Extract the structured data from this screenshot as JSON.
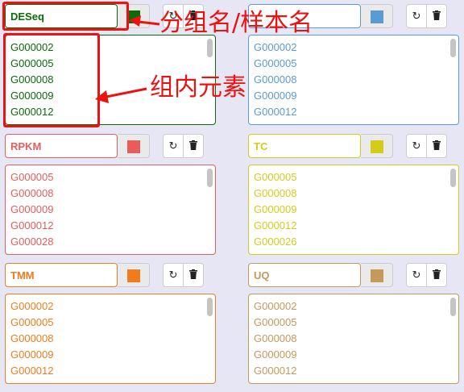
{
  "groups": [
    {
      "name": "DESeq",
      "color": "#0a6b0a",
      "items": [
        "G000002",
        "G000005",
        "G000008",
        "G000009",
        "G000012"
      ]
    },
    {
      "name": "",
      "color": "#5b9bd5",
      "items": [
        "G000002",
        "G000005",
        "G000008",
        "G000009",
        "G000012"
      ]
    },
    {
      "name": "RPKM",
      "color": "#e85c5c",
      "items": [
        "G000005",
        "G000008",
        "G000009",
        "G000012",
        "G000028"
      ]
    },
    {
      "name": "TC",
      "color": "#d4cc1a",
      "items": [
        "G000005",
        "G000008",
        "G000009",
        "G000012",
        "G000026"
      ]
    },
    {
      "name": "TMM",
      "color": "#f07c1e",
      "items": [
        "G000002",
        "G000005",
        "G000008",
        "G000009",
        "G000012"
      ]
    },
    {
      "name": "UQ",
      "color": "#c49a5a",
      "items": [
        "G000002",
        "G000005",
        "G000008",
        "G000009",
        "G000012"
      ]
    }
  ],
  "icons": {
    "refresh": "refresh-icon",
    "delete": "trash-icon"
  },
  "annotations": {
    "group_name_label": "分组名/样本名",
    "group_elements_label": "组内元素",
    "color": "#ee1111"
  }
}
